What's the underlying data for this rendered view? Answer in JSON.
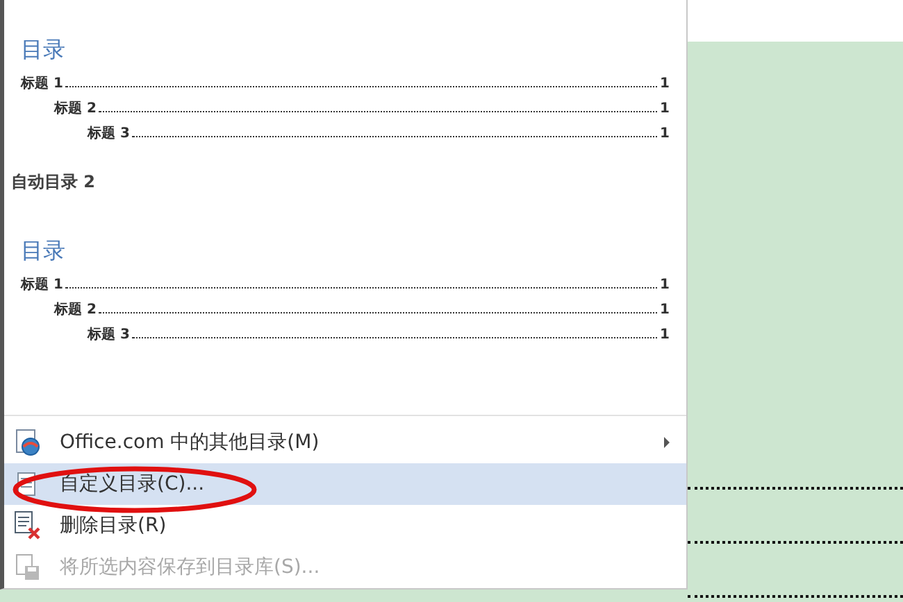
{
  "gallery": [
    {
      "heading": "目录",
      "entries": [
        {
          "label": "标题 1",
          "page": "1",
          "children": [
            {
              "label": "标题 2",
              "page": "1",
              "children": [
                {
                  "label": "标题 3",
                  "page": "1"
                }
              ]
            }
          ]
        }
      ]
    },
    {
      "caption": "自动目录 2",
      "heading": "目录",
      "entries": [
        {
          "label": "标题 1",
          "page": "1",
          "children": [
            {
              "label": "标题 2",
              "page": "1",
              "children": [
                {
                  "label": "标题 3",
                  "page": "1"
                }
              ]
            }
          ]
        }
      ]
    }
  ],
  "menu": [
    {
      "label": "Office.com 中的其他目录(M)",
      "kind": "submenu",
      "selected": false,
      "disabled": false
    },
    {
      "label": "自定义目录(C)...",
      "kind": "command",
      "selected": true,
      "disabled": false
    },
    {
      "label": "删除目录(R)",
      "kind": "command",
      "selected": false,
      "disabled": false
    },
    {
      "label": "将所选内容保存到目录库(S)...",
      "kind": "command",
      "selected": false,
      "disabled": true
    }
  ]
}
